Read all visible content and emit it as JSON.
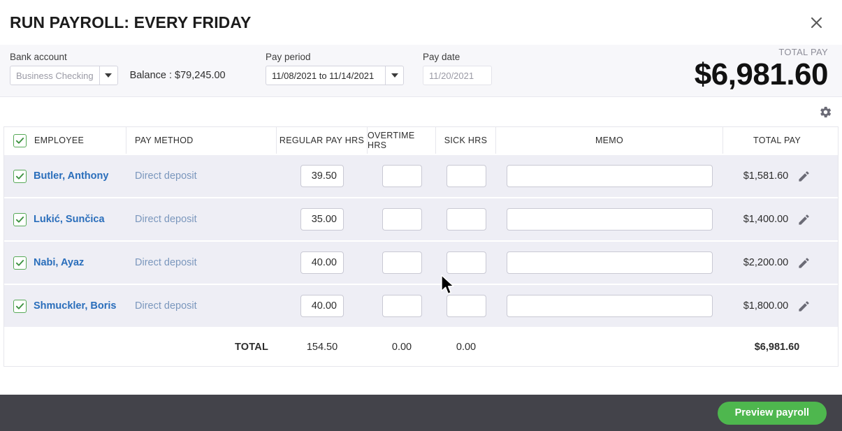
{
  "window": {
    "title": "RUN PAYROLL: EVERY FRIDAY",
    "close_icon": "close-icon"
  },
  "header": {
    "bank_account": {
      "label": "Bank account",
      "selected": "Business Checking",
      "balance_text": "Balance : $79,245.00"
    },
    "pay_period": {
      "label": "Pay period",
      "selected": "11/08/2021 to 11/14/2021"
    },
    "pay_date": {
      "label": "Pay date",
      "value": "11/20/2021",
      "placeholder": "11/20/2021"
    },
    "total_pay": {
      "label": "TOTAL PAY",
      "amount": "$6,981.60"
    }
  },
  "toolbar": {
    "settings_icon": "gear-icon"
  },
  "table": {
    "columns": [
      "EMPLOYEE",
      "PAY METHOD",
      "REGULAR PAY HRS",
      "OVERTIME HRS",
      "SICK HRS",
      "MEMO",
      "TOTAL PAY"
    ],
    "select_all_checked": true,
    "rows": [
      {
        "checked": true,
        "employee": "Butler, Anthony",
        "pay_method": "Direct deposit",
        "regular_hrs": "39.50",
        "overtime_hrs": "",
        "sick_hrs": "",
        "memo": "",
        "total_pay": "$1,581.60"
      },
      {
        "checked": true,
        "employee": "Lukić, Sunčica",
        "pay_method": "Direct deposit",
        "regular_hrs": "35.00",
        "overtime_hrs": "",
        "sick_hrs": "",
        "memo": "",
        "total_pay": "$1,400.00"
      },
      {
        "checked": true,
        "employee": "Nabi, Ayaz",
        "pay_method": "Direct deposit",
        "regular_hrs": "40.00",
        "overtime_hrs": "",
        "sick_hrs": "",
        "memo": "",
        "total_pay": "$2,200.00"
      },
      {
        "checked": true,
        "employee": "Shmuckler, Boris",
        "pay_method": "Direct deposit",
        "regular_hrs": "40.00",
        "overtime_hrs": "",
        "sick_hrs": "",
        "memo": "",
        "total_pay": "$1,800.00"
      }
    ],
    "totals": {
      "label": "TOTAL",
      "regular_hrs": "154.50",
      "overtime_hrs": "0.00",
      "sick_hrs": "0.00",
      "total_pay": "$6,981.60"
    }
  },
  "footer": {
    "preview_button": "Preview payroll"
  },
  "colors": {
    "accent_green": "#4eb74e",
    "link_blue": "#2a6ebb",
    "pay_method_blue": "#7b97bd",
    "row_background": "#eeeef5",
    "footer_background": "#43434a",
    "header_strip": "#f7f7fa"
  }
}
